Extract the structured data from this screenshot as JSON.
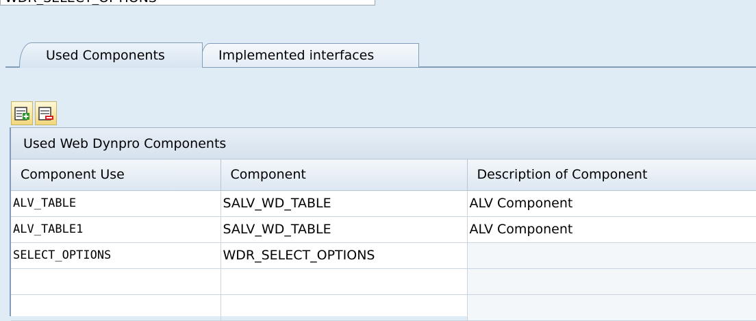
{
  "top_field": {
    "value": "WDR_SELECT_OPTIONS"
  },
  "tabs": [
    {
      "label": "Used Components",
      "active": true
    },
    {
      "label": "Implemented interfaces",
      "active": false
    }
  ],
  "toolbar": {
    "insert_row_icon": "insert-row-icon",
    "delete_row_icon": "delete-row-icon"
  },
  "table": {
    "title": "Used Web Dynpro Components",
    "columns": [
      "Component Use",
      "Component",
      "Description of Component"
    ],
    "rows": [
      [
        "ALV_TABLE",
        "SALV_WD_TABLE",
        "ALV Component"
      ],
      [
        "ALV_TABLE1",
        "SALV_WD_TABLE",
        "ALV Component"
      ],
      [
        "SELECT_OPTIONS",
        "WDR_SELECT_OPTIONS",
        ""
      ],
      [
        "",
        "",
        ""
      ],
      [
        "",
        "",
        ""
      ]
    ]
  },
  "colors": {
    "background": "#dfebf5",
    "accent_border": "#7f9db9",
    "button_fill": "#f2d77a"
  }
}
